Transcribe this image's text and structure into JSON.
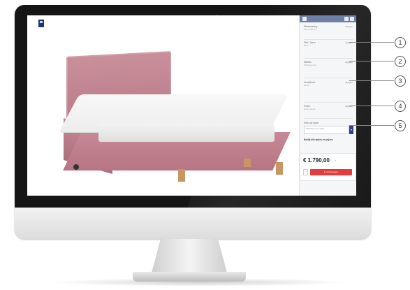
{
  "sidebar": {
    "sections": [
      {
        "label": "Maatvoering",
        "value": "160 x 200 cm",
        "change": "wijzigen"
      },
      {
        "label": "Stof / kleur",
        "value": "Roze",
        "change": "wijzigen"
      },
      {
        "label": "Matras",
        "value": "Pocketvering",
        "change": "wijzigen"
      },
      {
        "label": "Hoofdbord",
        "value": "Recht",
        "change": "wijzigen"
      },
      {
        "label": "Poten",
        "value": "Hout naturel",
        "change": "wijzigen"
      }
    ],
    "select_label": "Kies uw optie",
    "select_value": "Selecteer een optie",
    "note": "Bekijk alle opties en prijzen"
  },
  "price_box": {
    "price": "€ 1.790,00",
    "info": "i",
    "fav_icon": "♡",
    "cart_label": "In winkelwagen"
  },
  "callouts": [
    "1",
    "2",
    "3",
    "4",
    "5"
  ],
  "icons": [
    "logo-icon",
    "menu-icon",
    "search-icon",
    "cart-icon",
    "heart-icon",
    "chevron-down-icon"
  ],
  "colors": {
    "header": "#6e7fa8",
    "accent": "#e23c3c",
    "bed": "#c68997",
    "logo": "#22336b"
  }
}
